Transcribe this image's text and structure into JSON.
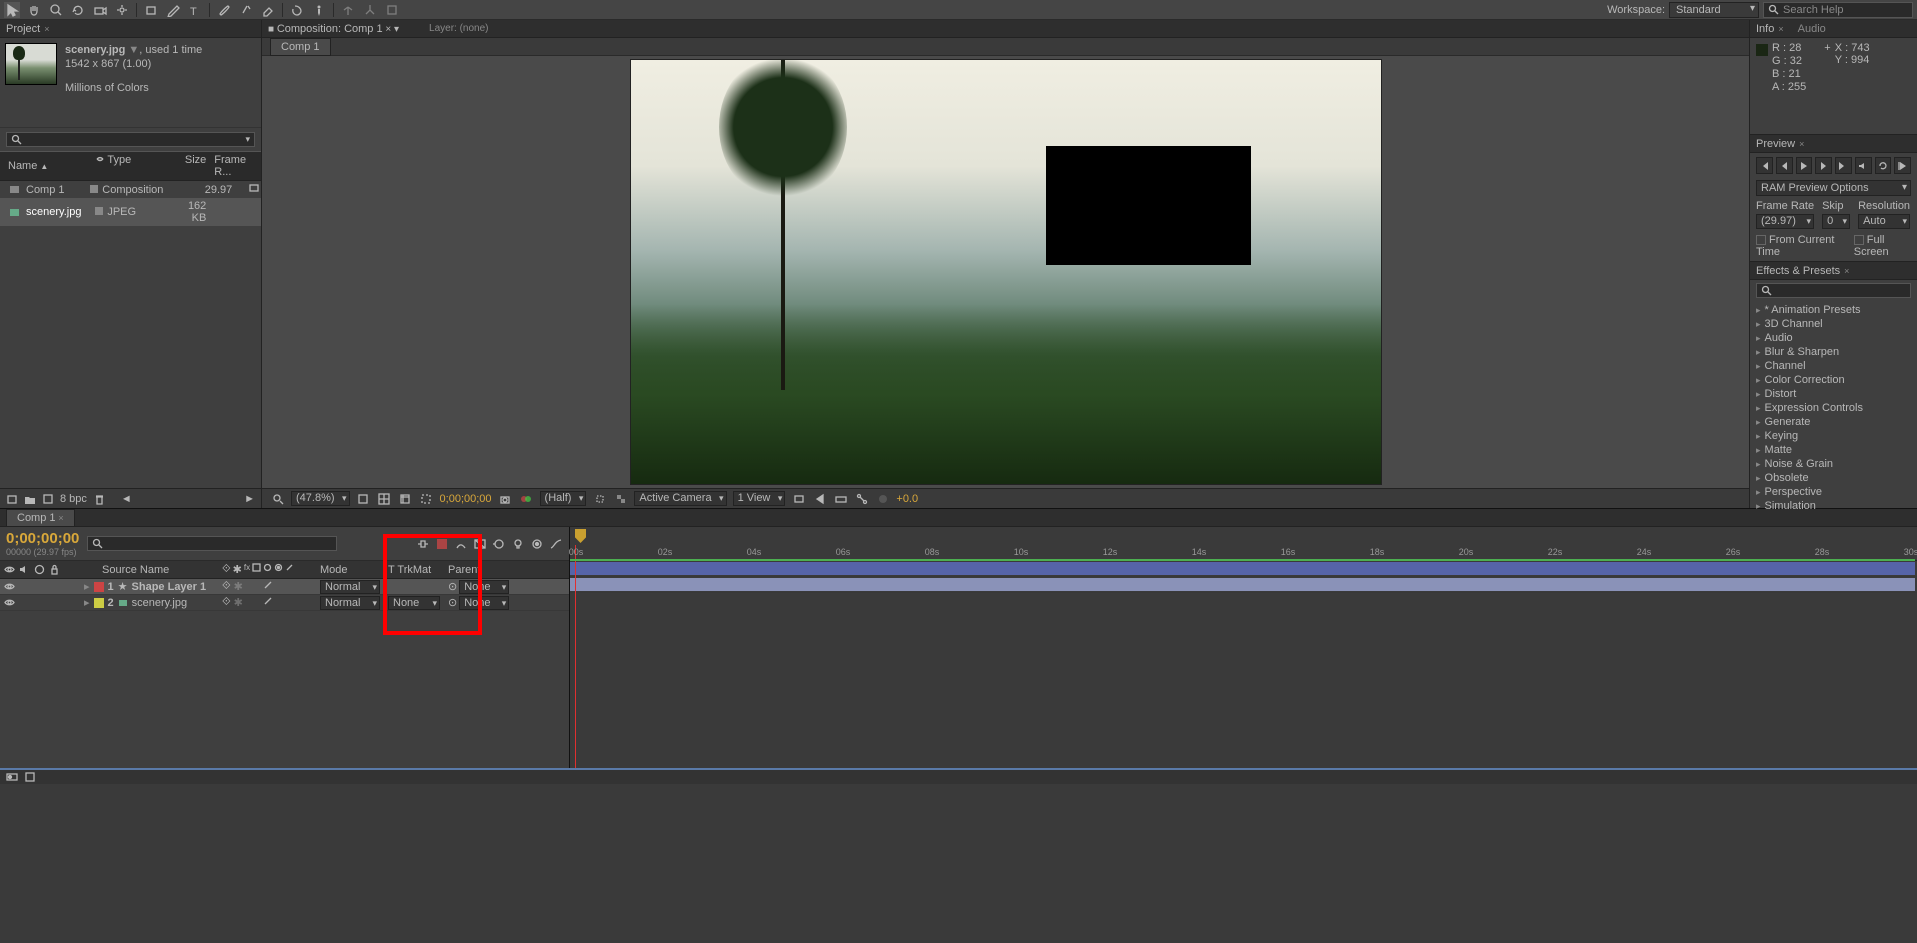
{
  "toolbar": {
    "workspace_label": "Workspace:",
    "workspace_value": "Standard",
    "search_placeholder": "Search Help"
  },
  "project": {
    "tab": "Project",
    "source_name": "scenery.jpg",
    "used": ", used 1 time",
    "dims": "1542 x 867 (1.00)",
    "colors": "Millions of Colors",
    "cols": {
      "name": "Name",
      "type": "Type",
      "size": "Size",
      "fr": "Frame R..."
    },
    "rows": [
      {
        "name": "Comp 1",
        "type": "Composition",
        "size": "",
        "fr": "29.97"
      },
      {
        "name": "scenery.jpg",
        "type": "JPEG",
        "size": "162 KB",
        "fr": ""
      }
    ],
    "bpc": "8 bpc"
  },
  "composition": {
    "panel_title": "Composition: Comp 1",
    "layer_title": "Layer: (none)",
    "tab": "Comp 1",
    "zoom": "(47.8%)",
    "time": "0;00;00;00",
    "half": "(Half)",
    "camera": "Active Camera",
    "view": "1 View",
    "exp": "+0.0"
  },
  "info": {
    "tab_info": "Info",
    "tab_audio": "Audio",
    "r": "R : 28",
    "g": "G : 32",
    "b": "B : 21",
    "a": "A : 255",
    "x": "X : 743",
    "y": "Y : 994"
  },
  "preview": {
    "tab": "Preview",
    "ram": "RAM Preview Options",
    "fr_label": "Frame Rate",
    "fr": "(29.97)",
    "skip_label": "Skip",
    "skip": "0",
    "res_label": "Resolution",
    "res": "Auto",
    "from": "From Current Time",
    "full": "Full Screen"
  },
  "effects": {
    "tab": "Effects & Presets",
    "items": [
      "* Animation Presets",
      "3D Channel",
      "Audio",
      "Blur & Sharpen",
      "Channel",
      "Color Correction",
      "Distort",
      "Expression Controls",
      "Generate",
      "Keying",
      "Matte",
      "Noise & Grain",
      "Obsolete",
      "Perspective",
      "Simulation"
    ]
  },
  "timeline": {
    "tab": "Comp 1",
    "timecode": "0;00;00;00",
    "tc_sub": "00000 (29.97 fps)",
    "cols": {
      "source": "Source Name",
      "mode": "Mode",
      "trk": "T   TrkMat",
      "parent": "Parent"
    },
    "layers": [
      {
        "num": "1",
        "name": "Shape Layer 1",
        "mode": "Normal",
        "trk": "",
        "parent": "None"
      },
      {
        "num": "2",
        "name": "scenery.jpg",
        "mode": "Normal",
        "trk": "None",
        "parent": "None"
      }
    ],
    "ticks": [
      "00s",
      "02s",
      "04s",
      "06s",
      "08s",
      "10s",
      "12s",
      "14s",
      "16s",
      "18s",
      "20s",
      "22s",
      "24s",
      "26s",
      "28s",
      "30s"
    ]
  }
}
